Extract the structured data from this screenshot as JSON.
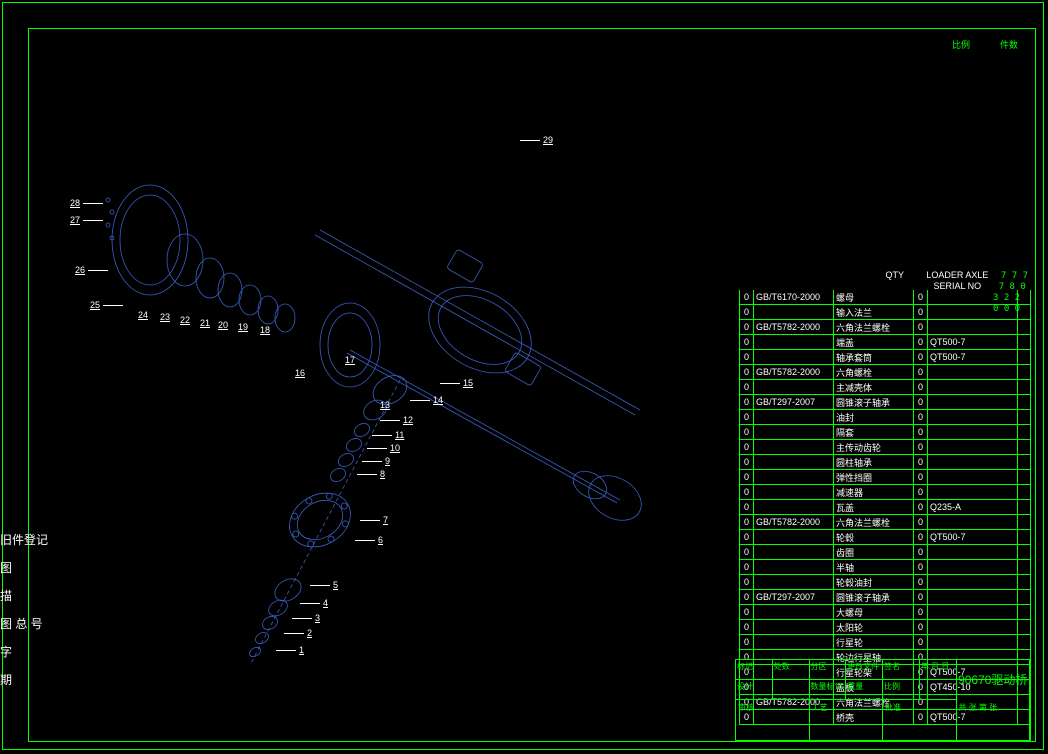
{
  "header_right": {
    "qty": "QTY",
    "label1": "LOADER AXLE",
    "label2": "SERIAL NO",
    "n1": "7 7 7",
    "n2": "7 8 0",
    "n3": "3 2 2",
    "n4": "0 0 0"
  },
  "top_labels": [
    "比例",
    "件数"
  ],
  "side_labels": [
    "旧件登记",
    "图",
    "描",
    "图 总 号",
    "字",
    "期"
  ],
  "callouts_top": [
    "29",
    "28",
    "27",
    "26",
    "25",
    "24",
    "23",
    "22",
    "21",
    "20",
    "19",
    "18",
    "17",
    "16"
  ],
  "callouts_mid": [
    "15",
    "14",
    "13",
    "12",
    "11",
    "10",
    "9",
    "8",
    "7",
    "6",
    "5",
    "4",
    "3",
    "2",
    "1"
  ],
  "bom": [
    {
      "std": "GB/T6170-2000",
      "name": "螺母",
      "mat": ""
    },
    {
      "std": "",
      "name": "输入法兰",
      "mat": ""
    },
    {
      "std": "GB/T5782-2000",
      "name": "六角法兰螺栓",
      "mat": ""
    },
    {
      "std": "",
      "name": "端盖",
      "mat": "QT500-7"
    },
    {
      "std": "",
      "name": "轴承套筒",
      "mat": "QT500-7"
    },
    {
      "std": "GB/T5782-2000",
      "name": "六角螺栓",
      "mat": ""
    },
    {
      "std": "",
      "name": "主减壳体",
      "mat": ""
    },
    {
      "std": "GB/T297-2007",
      "name": "圆锥滚子轴承",
      "mat": ""
    },
    {
      "std": "",
      "name": "油封",
      "mat": ""
    },
    {
      "std": "",
      "name": "隔套",
      "mat": ""
    },
    {
      "std": "",
      "name": "主传动齿轮",
      "mat": ""
    },
    {
      "std": "",
      "name": "圆柱轴承",
      "mat": ""
    },
    {
      "std": "",
      "name": "弹性挡圈",
      "mat": ""
    },
    {
      "std": "",
      "name": "减速器",
      "mat": ""
    },
    {
      "std": "",
      "name": "瓦盖",
      "mat": "Q235-A"
    },
    {
      "std": "GB/T5782-2000",
      "name": "六角法兰螺栓",
      "mat": ""
    },
    {
      "std": "",
      "name": "轮毂",
      "mat": "QT500-7"
    },
    {
      "std": "",
      "name": "齿圈",
      "mat": ""
    },
    {
      "std": "",
      "name": "半轴",
      "mat": ""
    },
    {
      "std": "",
      "name": "轮毂油封",
      "mat": ""
    },
    {
      "std": "GB/T297-2007",
      "name": "圆锥滚子轴承",
      "mat": ""
    },
    {
      "std": "",
      "name": "大螺母",
      "mat": ""
    },
    {
      "std": "",
      "name": "太阳轮",
      "mat": ""
    },
    {
      "std": "",
      "name": "行星轮",
      "mat": ""
    },
    {
      "std": "",
      "name": "轮边行星轴",
      "mat": ""
    },
    {
      "std": "",
      "name": "行星轮架",
      "mat": "QT500-7"
    },
    {
      "std": "",
      "name": "盖板",
      "mat": "QT450-10"
    },
    {
      "std": "GB/T5782-2000",
      "name": "六角法兰螺栓",
      "mat": ""
    },
    {
      "std": "",
      "name": "桥壳",
      "mat": "QT500-7"
    }
  ],
  "title_block": {
    "main": "90670驱动桥",
    "row_labels": [
      "标记",
      "处数",
      "分区",
      "更改文件",
      "签名",
      "年.月.日"
    ],
    "bottom_labels": [
      "设计",
      "审核",
      "工艺",
      "批准"
    ],
    "header_cells": [
      "数量标记",
      "重量",
      "比例"
    ],
    "char": "共    张    第    张"
  }
}
